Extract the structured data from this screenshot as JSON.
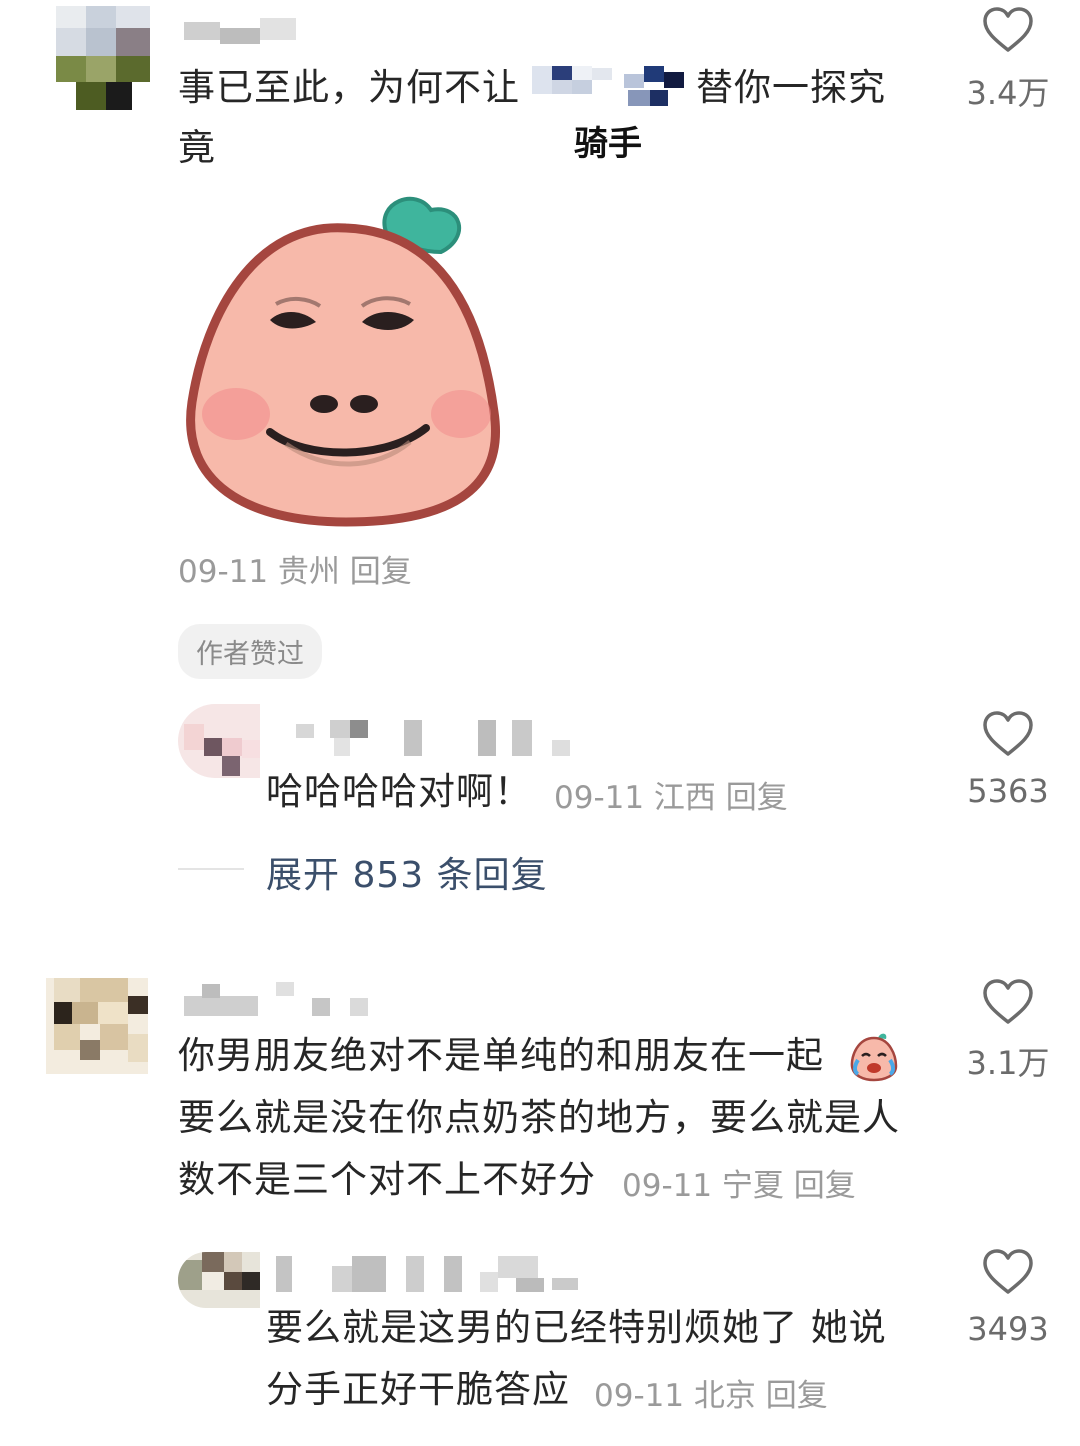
{
  "comments": [
    {
      "text_line1": "事已至此，为何不让",
      "text_line1b": "替你一探究",
      "text_line2": "竟",
      "inline_label": "骑手",
      "meta": "09-11 贵州 回复",
      "likes": "3.4万",
      "badge": "作者赞过",
      "reply": {
        "text": "哈哈哈哈对啊！",
        "meta": "09-11 江西 回复",
        "likes": "5363"
      },
      "expand_label": "展开 853 条回复"
    },
    {
      "text_line1": "你男朋友绝对不是单纯的和朋友在一起",
      "text_line2": "要么就是没在你点奶茶的地方，要么就是人",
      "text_line3": "数不是三个对不上不好分",
      "meta": "09-11 宁夏 回复",
      "likes": "3.1万",
      "reply": {
        "text_line1": "要么就是这男的已经特别烦她了 她说",
        "text_line2": "分手正好干脆答应",
        "meta": "09-11 北京 回复",
        "likes": "3493"
      }
    }
  ],
  "icons": {
    "like": "heart-outline-icon",
    "sticker": "peach-face-sticker",
    "emoji": "crying-peach-emoji"
  },
  "colors": {
    "text": "#262626",
    "meta": "#9a9a9a",
    "link": "#3b4f6b",
    "sticker_fill": "#f7b9aa",
    "sticker_outline": "#a5463f",
    "leaf": "#3fb59d"
  }
}
